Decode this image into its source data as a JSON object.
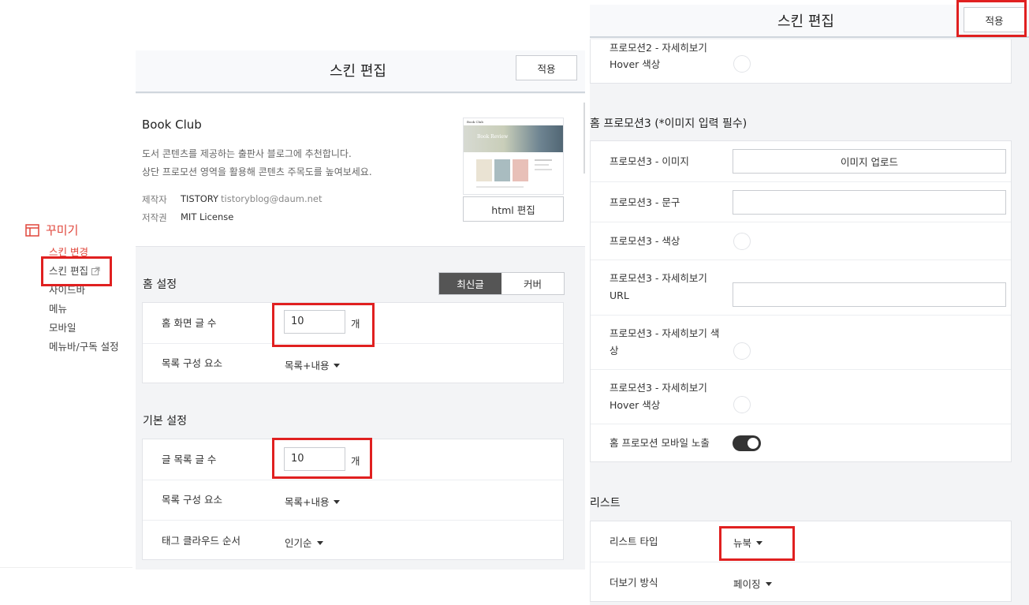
{
  "sidebar": {
    "section_label": "꾸미기",
    "items": [
      "스킨 변경",
      "스킨 편집",
      "사이드바",
      "메뉴",
      "모바일",
      "메뉴바/구독 설정"
    ]
  },
  "left_panel": {
    "title": "스킨 편집",
    "apply_label": "적용",
    "skin": {
      "name": "Book Club",
      "desc_line1": "도서 콘텐츠를 제공하는 출판사 블로그에 추천합니다.",
      "desc_line2": "상단 프로모션 영역을 활용해 콘텐츠 주목도를 높여보세요.",
      "maker_label": "제작자",
      "maker_value": "TISTORY",
      "maker_email": "tistoryblog@daum.net",
      "license_label": "저작권",
      "license_value": "MIT License",
      "html_edit_label": "html 편집",
      "thumb_brand": "Book Club",
      "thumb_banner": "Book Review"
    },
    "home": {
      "title": "홈 설정",
      "tab_latest": "최신글",
      "tab_cover": "커버",
      "post_count_label": "홈 화면 글 수",
      "post_count_value": "10",
      "unit": "개",
      "list_elem_label": "목록 구성 요소",
      "list_elem_value": "목록+내용"
    },
    "basic": {
      "title": "기본 설정",
      "list_count_label": "글 목록 글 수",
      "list_count_value": "10",
      "unit": "개",
      "list_elem_label": "목록 구성 요소",
      "list_elem_value": "목록+내용",
      "tag_order_label": "태그 클라우드 순서",
      "tag_order_value": "인기순"
    }
  },
  "right_panel": {
    "title": "스킨 편집",
    "apply_label": "적용",
    "promo2_hover_line1": "프로모션2 - 자세히보기",
    "promo2_hover_line2": "Hover 색상",
    "promo3_title": "홈 프로모션3 (*이미지 입력 필수)",
    "promo3_image_label": "프로모션3 - 이미지",
    "upload_label": "이미지 업로드",
    "promo3_text_label": "프로모션3 - 문구",
    "promo3_color_label": "프로모션3 - 색상",
    "promo3_url_line1": "프로모션3 - 자세히보기",
    "promo3_url_line2": "URL",
    "promo3_more_color_line1": "프로모션3 - 자세히보기 색",
    "promo3_more_color_line2": "상",
    "promo3_hover_line1": "프로모션3 - 자세히보기",
    "promo3_hover_line2": "Hover 색상",
    "mobile_show_label": "홈 프로모션 모바일 노출",
    "mobile_show_on": true,
    "list_title": "리스트",
    "list_type_label": "리스트 타입",
    "list_type_value": "뉴북",
    "more_label": "더보기 방식",
    "more_value": "페이징"
  },
  "colors": {
    "accent": "#e0473c",
    "highlight": "#e02020",
    "tab_active": "#555555"
  }
}
